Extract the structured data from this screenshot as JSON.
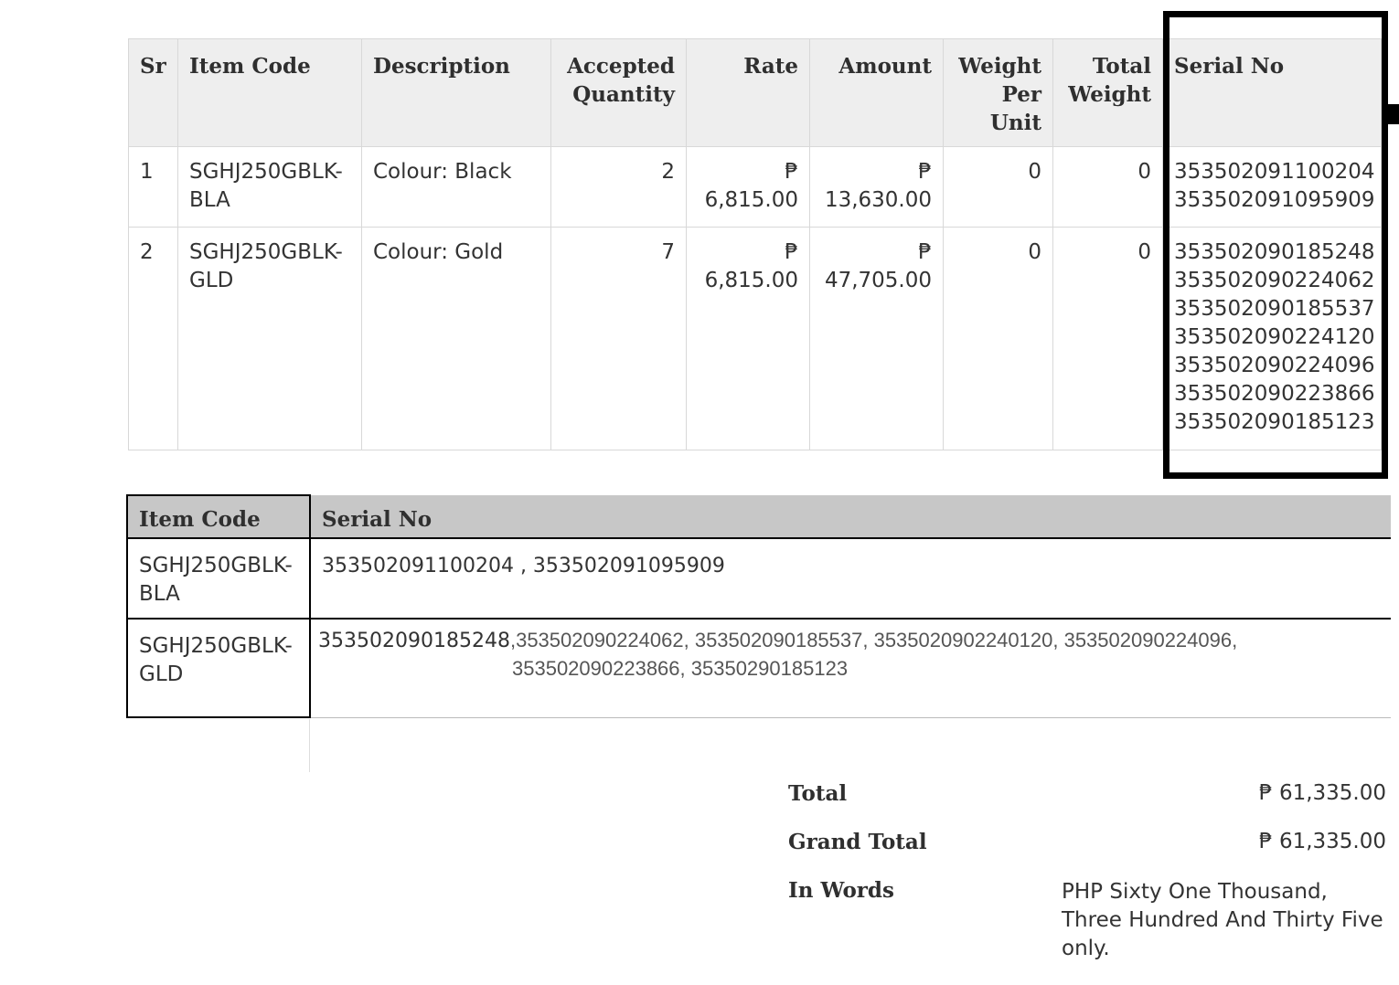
{
  "items_table": {
    "headers": {
      "sr": "Sr",
      "item_code": "Item Code",
      "description": "Description",
      "accepted_quantity": "Accepted Quantity",
      "rate": "Rate",
      "amount": "Amount",
      "weight_per_unit": "Weight Per Unit",
      "total_weight": "Total Weight",
      "serial_no": "Serial No"
    },
    "rows": [
      {
        "sr": "1",
        "item_code": "SGHJ250GBLK-BLA",
        "description": "Colour: Black",
        "accepted_quantity": "2",
        "rate_currency": "₱",
        "rate_value": "6,815.00",
        "amount_currency": "₱",
        "amount_value": "13,630.00",
        "weight_per_unit": "0",
        "total_weight": "0",
        "serials": [
          "353502091100204",
          "353502091095909"
        ]
      },
      {
        "sr": "2",
        "item_code": "SGHJ250GBLK-GLD",
        "description": "Colour: Gold",
        "accepted_quantity": "7",
        "rate_currency": "₱",
        "rate_value": "6,815.00",
        "amount_currency": "₱",
        "amount_value": "47,705.00",
        "weight_per_unit": "0",
        "total_weight": "0",
        "serials": [
          "353502090185248",
          "353502090224062",
          "353502090185537",
          "353502090224120",
          "353502090224096",
          "353502090223866",
          "353502090185123"
        ]
      }
    ]
  },
  "serial_table": {
    "headers": {
      "item_code": "Item Code",
      "serial_no": "Serial No"
    },
    "rows": [
      {
        "item_code": "SGHJ250GBLK-BLA",
        "serials": "353502091100204 , 353502091095909"
      },
      {
        "item_code": "SGHJ250GBLK-GLD",
        "serial_first": "353502090185248",
        "serial_rest_line1": ",353502090224062, 353502090185537, 353502090224012 0, 353502090224096,",
        "serial_rest_line1_exact": ",353502090224062, 353502090185537, 3535020902240120, 353502090224096,",
        "serial_rest_line2": "353502090223866, 35350290185123"
      }
    ]
  },
  "totals": {
    "total_label": "Total",
    "total_value": "₱ 61,335.00",
    "grand_total_label": "Grand Total",
    "grand_total_value": "₱ 61,335.00",
    "in_words_label": "In Words",
    "in_words_value": "PHP Sixty One Thousand, Three Hundred And Thirty Five only."
  }
}
